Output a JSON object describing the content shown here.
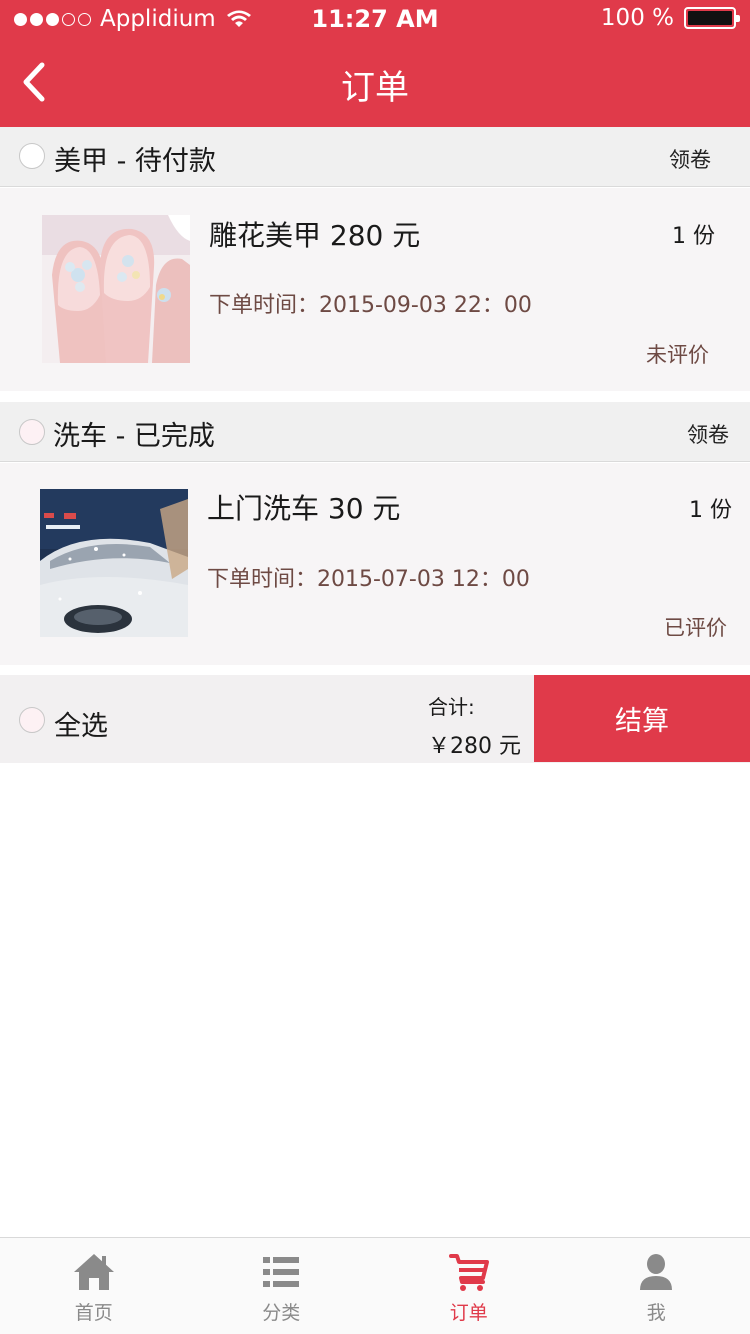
{
  "status_bar": {
    "carrier": "Applidium",
    "time": "11:27 AM",
    "battery": "100 %",
    "signal_bars_filled": 3,
    "signal_bars_total": 5,
    "battery_level": 1.0
  },
  "nav": {
    "title": "订单",
    "back_icon": "chevron-left-icon"
  },
  "orders": [
    {
      "section_title": "美甲 - 待付款",
      "coupon_label": "领卷",
      "item_name": "雕花美甲 280 元",
      "quantity": "1 份",
      "order_time": "下单时间：2015-09-03 22：00",
      "review_status": "未评价",
      "selected": false
    },
    {
      "section_title": "洗车 - 已完成",
      "coupon_label": "领卷",
      "item_name": "上门洗车 30 元",
      "quantity": "1 份",
      "order_time": "下单时间：2015-07-03 12：00",
      "review_status": "已评价",
      "selected": false
    }
  ],
  "checkout": {
    "select_all_label": "全选",
    "total_label": "合计:",
    "total_value": "￥280 元",
    "settle_label": "结算"
  },
  "tab_bar": {
    "active_index": 2,
    "tabs": [
      {
        "label": "首页",
        "icon": "home-icon"
      },
      {
        "label": "分类",
        "icon": "list-icon"
      },
      {
        "label": "订单",
        "icon": "cart-icon"
      },
      {
        "label": "我",
        "icon": "user-icon"
      }
    ]
  },
  "colors": {
    "accent": "#e03a4a",
    "inactive_tab": "#8a8a8a",
    "meta_text": "#6e4a44"
  }
}
